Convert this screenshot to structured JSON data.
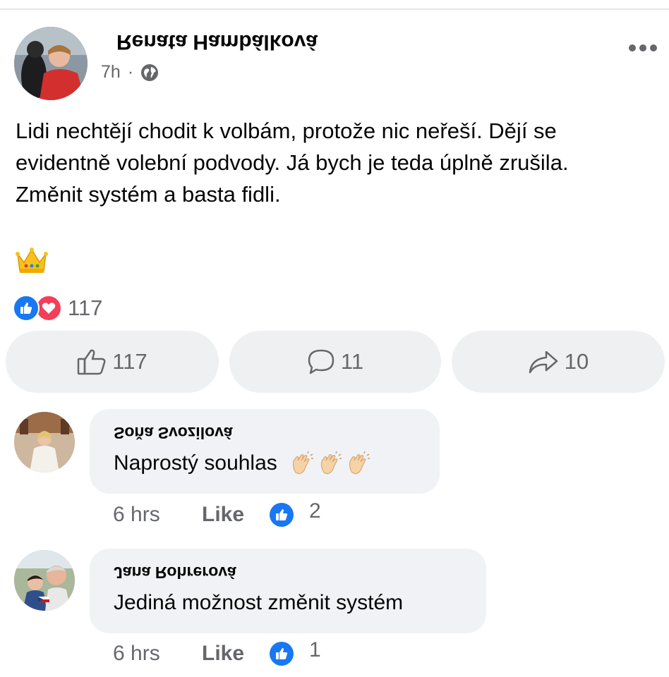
{
  "post": {
    "author_name": "Renata Hambálková",
    "timestamp": "7h",
    "separator": "·",
    "audience_icon": "globe-icon",
    "text_lines": [
      "Lidi nechtějí chodit k volbám, protože nic neřeší. Dějí se",
      "evidentně volební podvody. Já bych je teda úplně zrušila.",
      "Změnit systém a basta fidli."
    ],
    "emoji": "crown-icon"
  },
  "reactions": {
    "types": [
      "like-icon",
      "love-icon"
    ],
    "count": "117"
  },
  "actions": {
    "like_count": "117",
    "comment_count": "11",
    "share_count": "10"
  },
  "comments": [
    {
      "name": "Soňa Svozilová",
      "text": "Naprostý souhlas",
      "emoji": [
        "clap-icon",
        "clap-icon",
        "clap-icon"
      ],
      "time": "6 hrs",
      "like_label": "Like",
      "like_count": "2"
    },
    {
      "name": "Jana Rohrerová",
      "text": "Jediná možnost změnit systém",
      "time": "6 hrs",
      "like_label": "Like",
      "like_count": "1"
    }
  ],
  "colors": {
    "facebook_blue": "#1877f2",
    "love_red": "#f33e58",
    "secondary_text": "#65676b",
    "button_bg": "#eef0f2",
    "bubble_bg": "#f0f2f5"
  }
}
